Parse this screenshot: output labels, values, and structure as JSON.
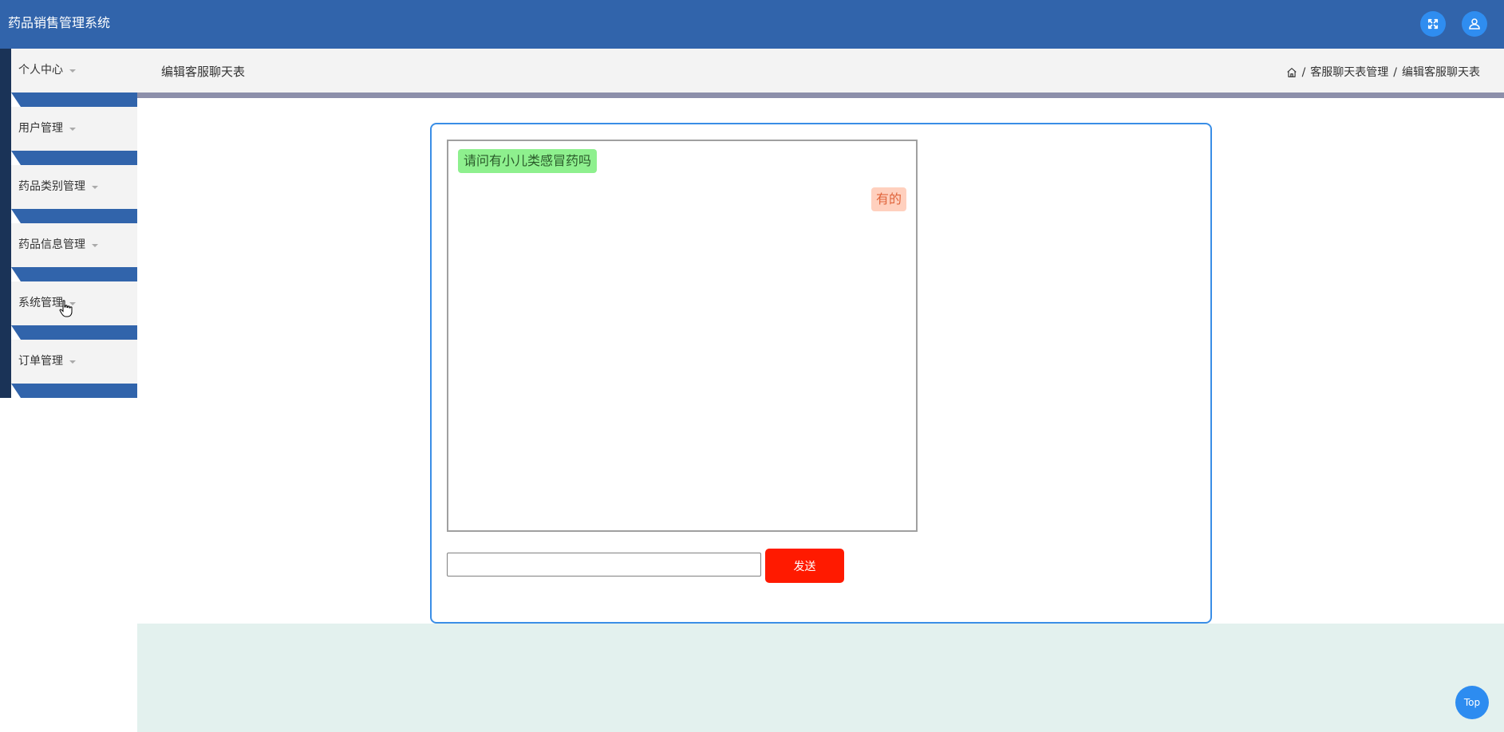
{
  "header": {
    "app_title": "药品销售管理系统",
    "fullscreen_icon": "fullscreen-icon",
    "user_icon": "user-icon"
  },
  "sidebar": {
    "items": [
      {
        "label": "个人中心"
      },
      {
        "label": "用户管理"
      },
      {
        "label": "药品类别管理"
      },
      {
        "label": "药品信息管理"
      },
      {
        "label": "系统管理"
      },
      {
        "label": "订单管理"
      }
    ]
  },
  "content_header": {
    "title": "编辑客服聊天表",
    "breadcrumb": {
      "home_icon": "home-icon",
      "separator": "/",
      "level1": "客服聊天表管理",
      "level2": "编辑客服聊天表"
    }
  },
  "chat": {
    "messages": [
      {
        "text": "请问有小儿类感冒药吗",
        "side": "left"
      },
      {
        "text": "有的",
        "side": "right"
      }
    ],
    "input_value": "",
    "send_label": "发送"
  },
  "back_to_top": {
    "label": "Top"
  },
  "colors": {
    "topbar": "#3164ab",
    "accent": "#2d8cf0",
    "send_button": "#ff1a00",
    "card_border": "#3a8ee6",
    "left_bubble": "#8ef08e",
    "right_bubble": "#ffd0be"
  }
}
